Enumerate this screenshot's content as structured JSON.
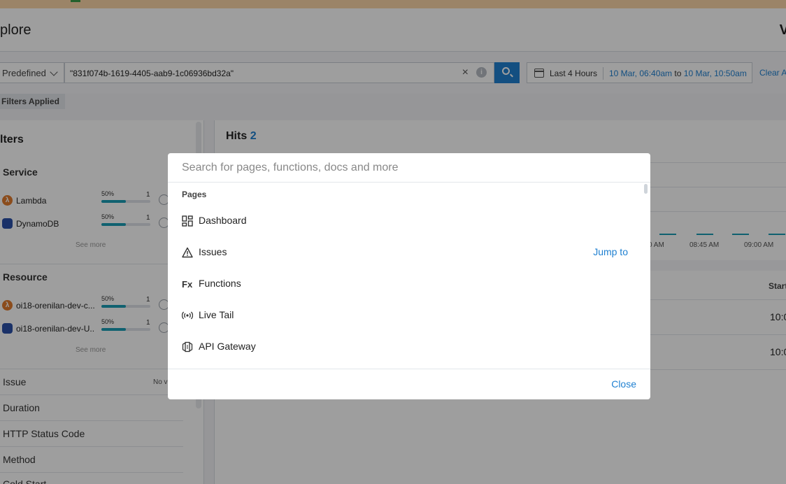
{
  "header": {
    "title": "plore",
    "right_glyph": "V"
  },
  "search": {
    "mode": "Predefined",
    "query": "\"831f074b-1619-4405-aab9-1c06936bd32a\"",
    "clear_glyph": "×",
    "info_glyph": "i"
  },
  "date": {
    "preset": "Last 4 Hours",
    "from": "10 Mar, 06:40am",
    "to_word": "to",
    "to": "10 Mar, 10:50am",
    "clear": "Clear A"
  },
  "filters_chip": "Filters Applied",
  "left": {
    "title": "lters",
    "service_heading": "Service",
    "services": [
      {
        "name": "Lambda",
        "pct": "50%",
        "fill": 0.5,
        "count": "1",
        "icon": "lambda-icon"
      },
      {
        "name": "DynamoDB",
        "pct": "50%",
        "fill": 0.5,
        "count": "1",
        "icon": "dynamodb-icon"
      }
    ],
    "see_more": "See more",
    "resource_heading": "Resource",
    "resources": [
      {
        "name": "oi18-orenilan-dev-c...",
        "pct": "50%",
        "fill": 0.5,
        "count": "1",
        "icon": "lambda-icon"
      },
      {
        "name": "oi18-orenilan-dev-U...",
        "pct": "50%",
        "fill": 0.5,
        "count": "1",
        "icon": "dynamodb-icon"
      }
    ],
    "rows": [
      "Issue",
      "Duration",
      "HTTP Status Code",
      "Method",
      "Cold Start"
    ],
    "no_value": "No v"
  },
  "right": {
    "hits_label": "Hits",
    "hits_count": "2",
    "ticks": [
      "0 AM",
      "08:45 AM",
      "09:00 AM"
    ],
    "start_col": "Start",
    "cells": [
      "10:0",
      "10:0"
    ]
  },
  "modal": {
    "placeholder": "Search for pages, functions, docs and more",
    "section": "Pages",
    "items": [
      {
        "label": "Dashboard",
        "icon": "dashboard-icon"
      },
      {
        "label": "Issues",
        "icon": "warning-icon",
        "action": "Jump to"
      },
      {
        "label": "Functions",
        "icon": "fx-icon"
      },
      {
        "label": "Live Tail",
        "icon": "broadcast-icon"
      },
      {
        "label": "API Gateway",
        "icon": "api-gateway-icon"
      }
    ],
    "close": "Close"
  }
}
